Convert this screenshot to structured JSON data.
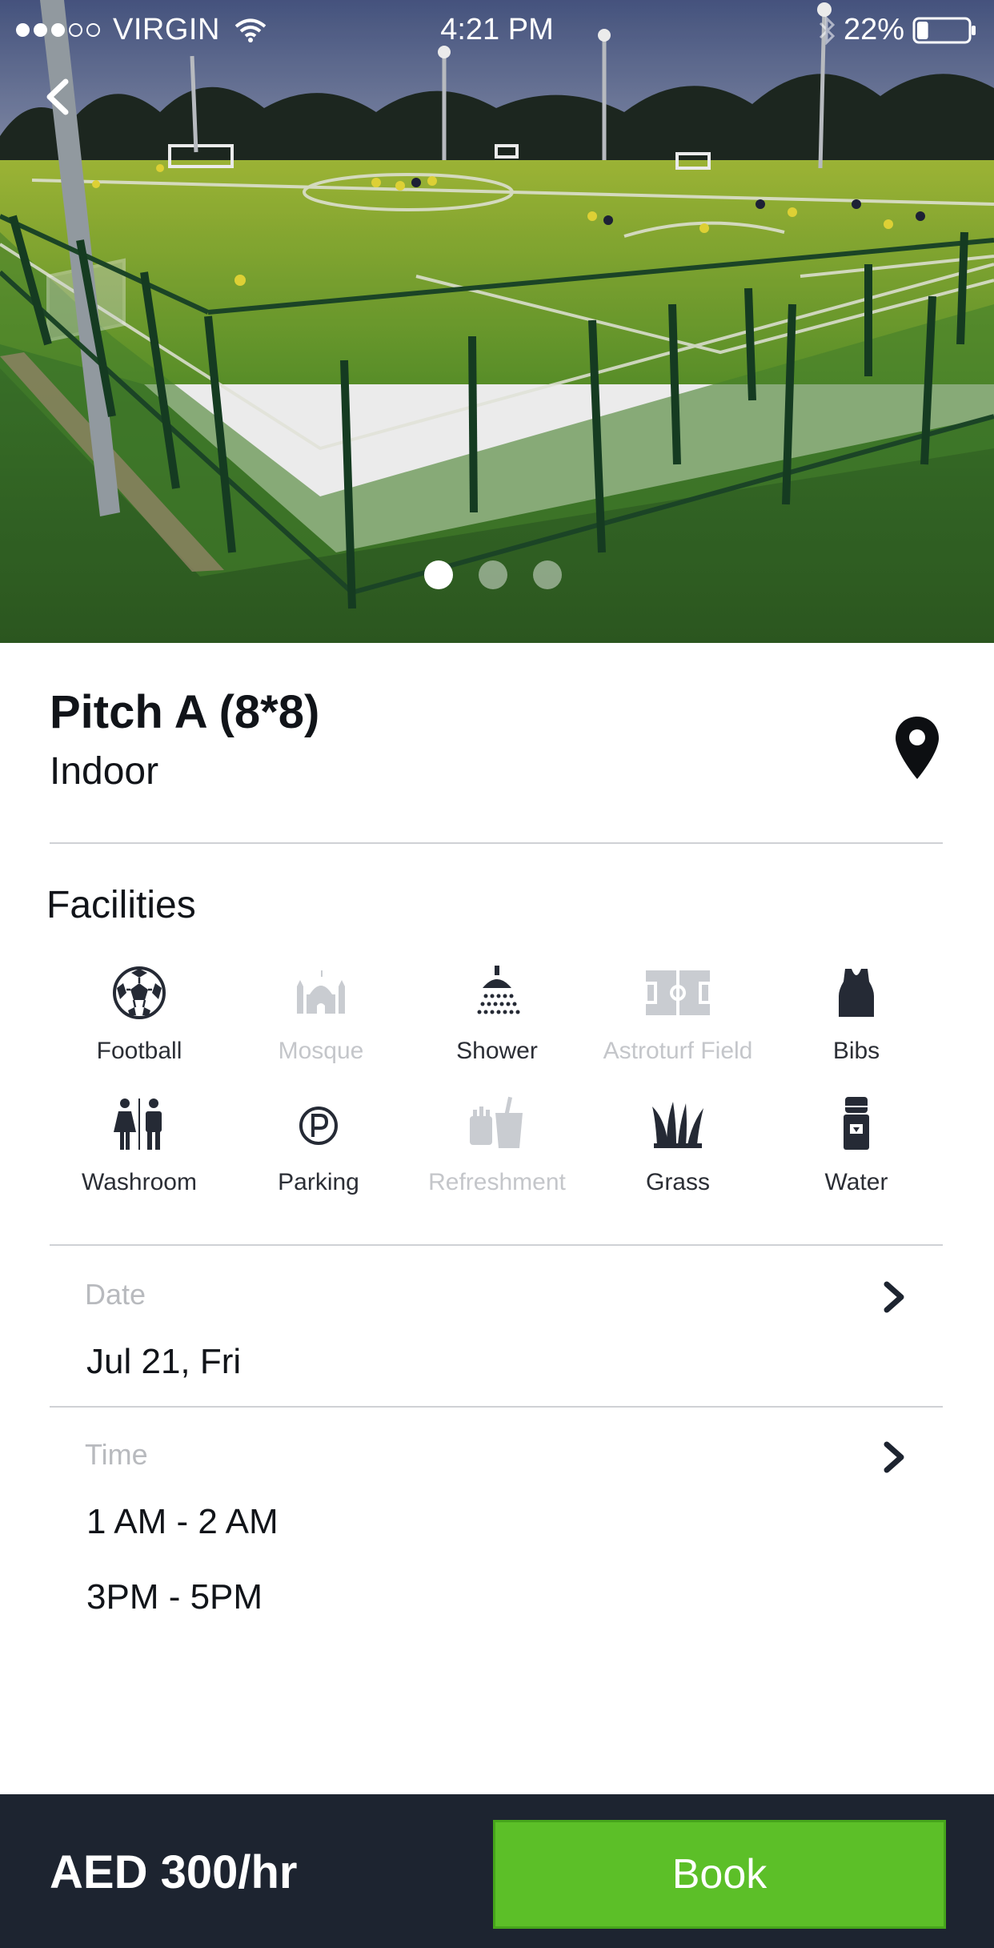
{
  "status_bar": {
    "carrier": "VIRGIN",
    "time": "4:21 PM",
    "battery": "22%",
    "signal_bars": 3,
    "signal_total": 5,
    "battery_level": 0.22
  },
  "gallery": {
    "image_count": 3,
    "active_index": 0,
    "icons": {
      "back": "chevron-left-icon"
    }
  },
  "venue": {
    "title": "Pitch A (8*8)",
    "subtitle": "Indoor",
    "location_icon": "map-pin-icon"
  },
  "facilities": {
    "heading": "Facilities",
    "items": [
      {
        "label": "Football",
        "icon": "football-icon",
        "available": true
      },
      {
        "label": "Mosque",
        "icon": "mosque-icon",
        "available": false
      },
      {
        "label": "Shower",
        "icon": "shower-icon",
        "available": true
      },
      {
        "label": "Astroturf Field",
        "icon": "field-icon",
        "available": false
      },
      {
        "label": "Bibs",
        "icon": "bib-icon",
        "available": true
      },
      {
        "label": "Washroom",
        "icon": "washroom-icon",
        "available": true
      },
      {
        "label": "Parking",
        "icon": "parking-icon",
        "available": true
      },
      {
        "label": "Refreshment",
        "icon": "refreshment-icon",
        "available": false
      },
      {
        "label": "Grass",
        "icon": "grass-icon",
        "available": true
      },
      {
        "label": "Water",
        "icon": "water-dispenser-icon",
        "available": true
      }
    ]
  },
  "booking": {
    "date_label": "Date",
    "date_value": "Jul 21, Fri",
    "time_label": "Time",
    "time_slots": [
      "1 AM - 2 AM",
      "3PM - 5PM"
    ]
  },
  "footer": {
    "price": "AED 300/hr",
    "book_label": "Book"
  },
  "colors": {
    "accent_green": "#5cbf28",
    "footer_bg": "#1d2430",
    "disabled_text": "#c4c6ca",
    "icon_dark": "#252a35"
  }
}
